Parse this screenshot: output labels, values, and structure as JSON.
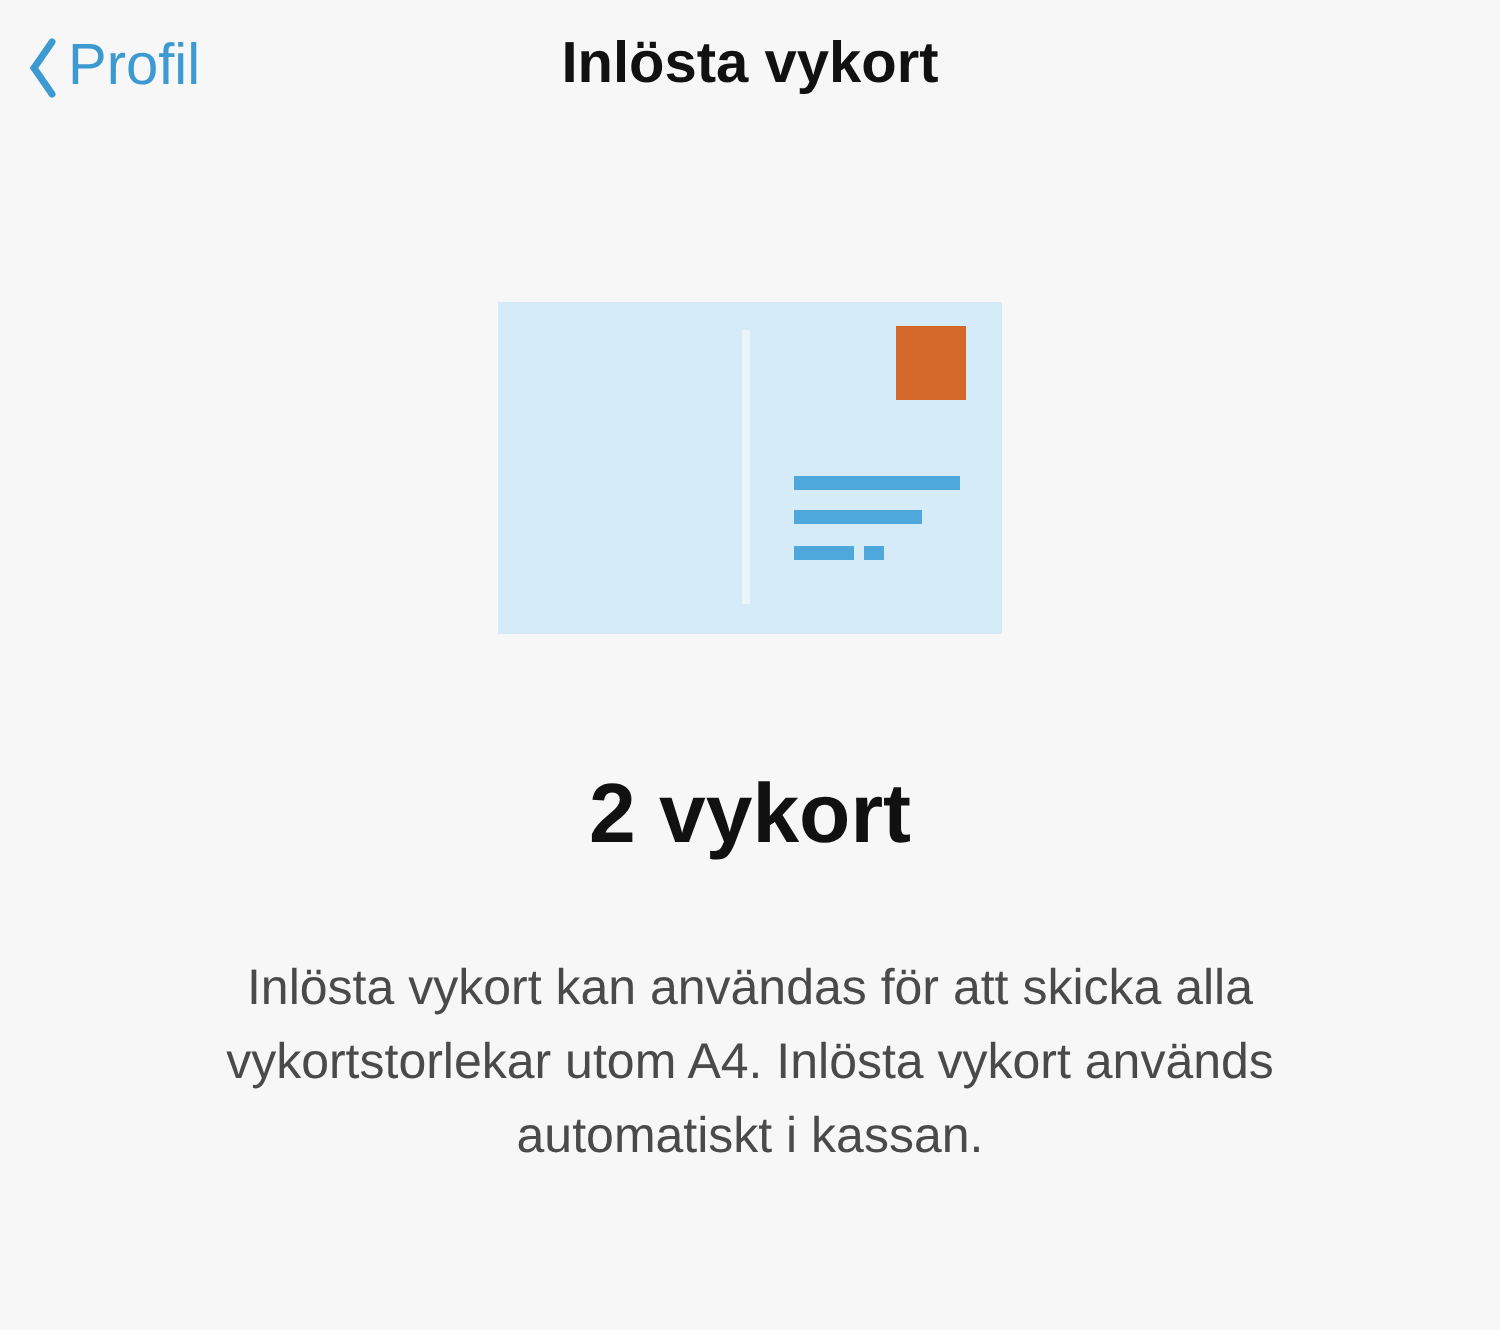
{
  "nav": {
    "back_label": "Profil",
    "title": "Inlösta vykort"
  },
  "count": "2 vykort",
  "description": "Inlösta vykort kan användas för att skicka alla vykortstorlekar utom A4. Inlösta vykort används automatiskt i kassan."
}
